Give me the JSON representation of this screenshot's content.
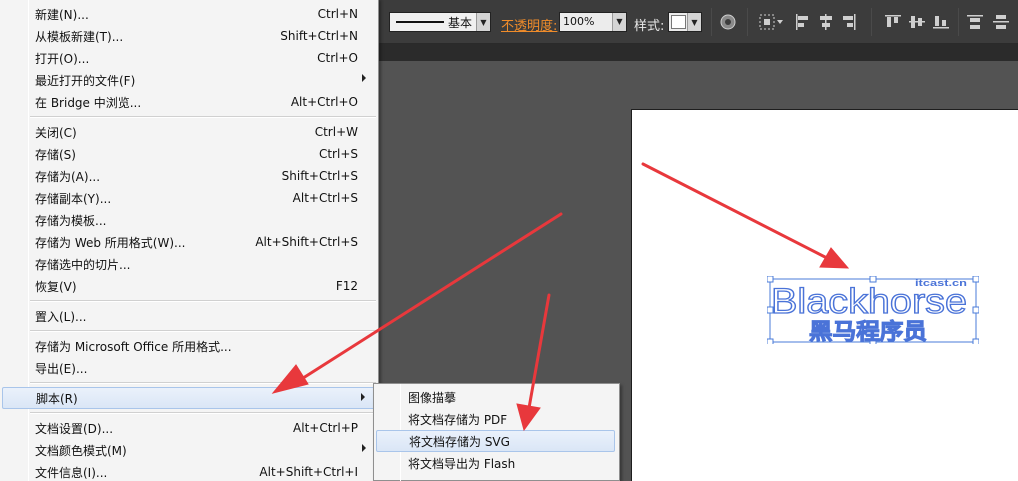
{
  "control_bar": {
    "stroke_style": "基本",
    "opacity_label": "不透明度:",
    "opacity_value": "100%",
    "style_label": "样式:"
  },
  "file_menu": {
    "items": [
      {
        "label": "新建(N)...",
        "shortcut": "Ctrl+N"
      },
      {
        "label": "从模板新建(T)...",
        "shortcut": "Shift+Ctrl+N"
      },
      {
        "label": "打开(O)...",
        "shortcut": "Ctrl+O"
      },
      {
        "label": "最近打开的文件(F)",
        "shortcut": ""
      },
      {
        "label": "在 Bridge 中浏览...",
        "shortcut": "Alt+Ctrl+O"
      },
      {
        "label": "关闭(C)",
        "shortcut": "Ctrl+W"
      },
      {
        "label": "存储(S)",
        "shortcut": "Ctrl+S"
      },
      {
        "label": "存储为(A)...",
        "shortcut": "Shift+Ctrl+S"
      },
      {
        "label": "存储副本(Y)...",
        "shortcut": "Alt+Ctrl+S"
      },
      {
        "label": "存储为模板...",
        "shortcut": ""
      },
      {
        "label": "存储为 Web 所用格式(W)...",
        "shortcut": "Alt+Shift+Ctrl+S"
      },
      {
        "label": "存储选中的切片...",
        "shortcut": ""
      },
      {
        "label": "恢复(V)",
        "shortcut": "F12"
      },
      {
        "label": "置入(L)...",
        "shortcut": ""
      },
      {
        "label": "存储为 Microsoft Office 所用格式...",
        "shortcut": ""
      },
      {
        "label": "导出(E)...",
        "shortcut": ""
      },
      {
        "label": "脚本(R)",
        "shortcut": ""
      },
      {
        "label": "文档设置(D)...",
        "shortcut": "Alt+Ctrl+P"
      },
      {
        "label": "文档颜色模式(M)",
        "shortcut": ""
      },
      {
        "label": "文件信息(I)...",
        "shortcut": "Alt+Shift+Ctrl+I"
      }
    ]
  },
  "script_submenu": {
    "items": [
      {
        "label": "图像描摹"
      },
      {
        "label": "将文档存储为 PDF"
      },
      {
        "label": "将文档存储为 SVG"
      },
      {
        "label": "将文档导出为 Flash"
      }
    ]
  },
  "artwork": {
    "main_text": "Blackhorse",
    "sub_text": "黑马程序员",
    "corner_text": "itcast.cn",
    "color": "#4a73d8"
  },
  "colors": {
    "arrow": "#e8383c",
    "selection": "#4a7bd8",
    "menu_highlight_border": "#a9c5ea"
  }
}
